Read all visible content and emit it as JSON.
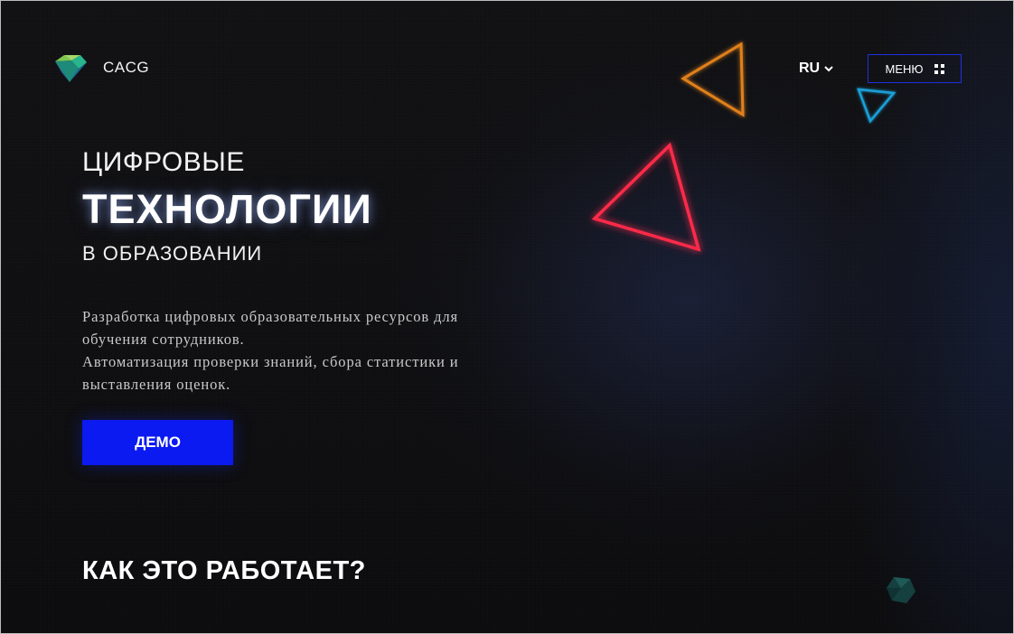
{
  "header": {
    "logo_text": "CACG",
    "lang_label": "RU",
    "menu_label": "МЕНЮ"
  },
  "hero": {
    "line1": "ЦИФРОВЫЕ",
    "line2": "ТЕХНОЛОГИИ",
    "line3": "В ОБРАЗОВАНИИ",
    "desc_line1": "Разработка цифровых образовательных ресурсов для",
    "desc_line2": "обучения сотрудников.",
    "desc_line3": "Автоматизация проверки знаний, сбора статистики и",
    "desc_line4": "выставления оценок.",
    "demo_label": "ДЕМО"
  },
  "section": {
    "title": "КАК ЭТО РАБОТАЕТ?"
  },
  "colors": {
    "accent": "#0a1af0",
    "menu_border": "#1f2fe0",
    "triangle_red": "#ff2a4a",
    "triangle_orange": "#e0801a",
    "triangle_blue": "#1aa0d8",
    "background": "#0f0f11"
  },
  "icons": {
    "logo": "logo-mark-icon",
    "lang": "chevron-down-icon",
    "menu": "grid-dots-icon"
  }
}
